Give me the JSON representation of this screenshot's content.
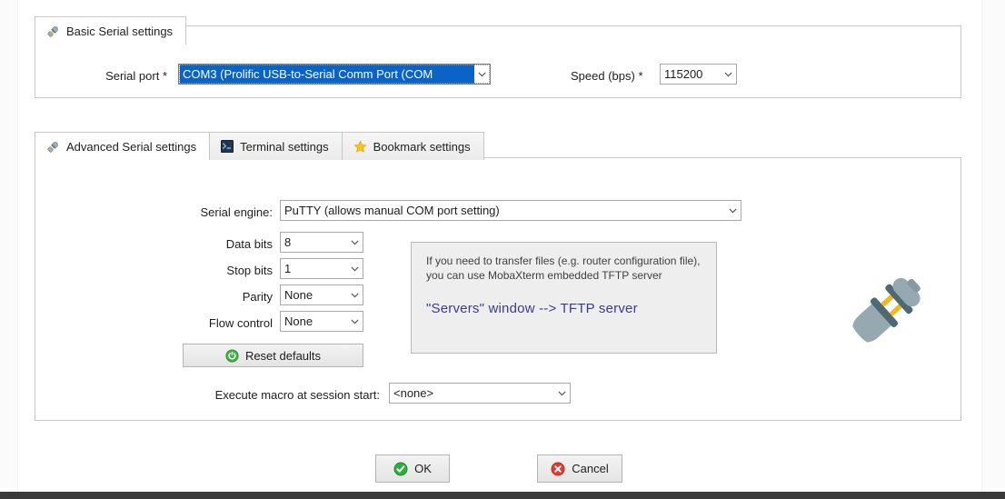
{
  "basic_panel": {
    "tab": {
      "label": "Basic Serial settings",
      "icon": "plug-icon"
    },
    "serial_port": {
      "label": "Serial port",
      "required_marker": "*",
      "value": "COM3  (Prolific USB-to-Serial Comm Port (COM",
      "selected": true
    },
    "speed": {
      "label": "Speed (bps)",
      "required_marker": "*",
      "value": "115200"
    }
  },
  "advanced_panel": {
    "tabs": [
      {
        "label": "Advanced Serial settings",
        "icon": "plug-icon",
        "active": true
      },
      {
        "label": "Terminal settings",
        "icon": "terminal-icon",
        "active": false
      },
      {
        "label": "Bookmark settings",
        "icon": "star-icon",
        "active": false
      }
    ],
    "fields": [
      {
        "name": "serial-engine",
        "label": "Serial engine:",
        "value": "PuTTY   (allows manual COM port setting)"
      },
      {
        "name": "data-bits",
        "label": "Data bits",
        "value": "8"
      },
      {
        "name": "stop-bits",
        "label": "Stop bits",
        "value": "1"
      },
      {
        "name": "parity",
        "label": "Parity",
        "value": "None"
      },
      {
        "name": "flow-control",
        "label": "Flow control",
        "value": "None"
      },
      {
        "name": "execute-macro",
        "label": "Execute macro at session start:",
        "value": "<none>"
      }
    ],
    "reset_button": {
      "label": "Reset defaults",
      "icon": "power-refresh-icon"
    },
    "note": {
      "text": "If you need to transfer files (e.g. router configuration file), you can use MobaXterm embedded TFTP server",
      "link": "\"Servers\" window  -->  TFTP server",
      "link_color": "#3b3b8f"
    },
    "decoration": {
      "icon": "plug-connector-icon"
    }
  },
  "dialog_buttons": {
    "ok": {
      "label": "OK",
      "icon": "check-circle-icon",
      "color": "#2eae3f"
    },
    "cancel": {
      "label": "Cancel",
      "icon": "x-circle-icon",
      "color": "#e03c31"
    }
  },
  "colors": {
    "selection_blue": "#0a64c8",
    "panel_border": "#c8c8c8",
    "note_bg": "#eeeeee"
  }
}
